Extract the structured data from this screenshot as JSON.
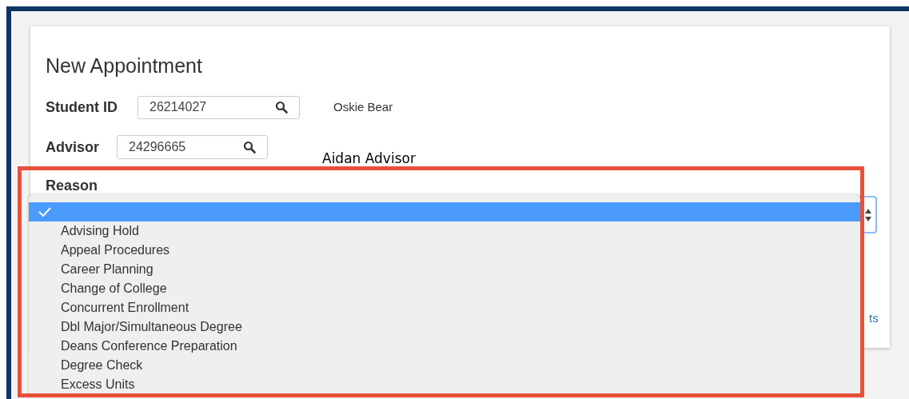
{
  "title": "New Appointment",
  "student_id": {
    "label": "Student ID",
    "value": "26214027",
    "name": "Oskie Bear"
  },
  "advisor": {
    "label": "Advisor",
    "value": "24296665",
    "name": "Aidan Advisor"
  },
  "reason": {
    "label": "Reason",
    "options": [
      {
        "selected": true
      },
      {
        "label": "Advising Hold",
        "selected": false
      },
      {
        "label": "Appeal Procedures",
        "selected": false
      },
      {
        "label": "Career Planning",
        "selected": false
      },
      {
        "label": "Change of College",
        "selected": false
      },
      {
        "label": "Concurrent Enrollment",
        "selected": false
      },
      {
        "label": "Dbl Major/Simultaneous Degree",
        "selected": false
      },
      {
        "label": "Deans Conference Preparation",
        "selected": false
      },
      {
        "label": "Degree Check",
        "selected": false
      },
      {
        "label": "Excess Units",
        "selected": false
      }
    ]
  },
  "link": "ts"
}
